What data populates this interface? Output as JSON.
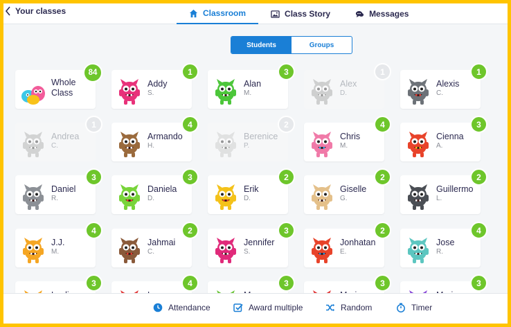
{
  "header": {
    "back_label": "Your classes",
    "tabs": [
      {
        "label": "Classroom",
        "icon": "home-icon",
        "active": true
      },
      {
        "label": "Class Story",
        "icon": "image-icon",
        "active": false
      },
      {
        "label": "Messages",
        "icon": "chat-icon",
        "active": false
      }
    ]
  },
  "toggle": {
    "students": "Students",
    "groups": "Groups",
    "selected": "Students"
  },
  "colors": {
    "accent": "#1a7fd6",
    "points_badge": "#6ec62b",
    "frame": "#ffc400"
  },
  "students": [
    {
      "first": "Whole Class",
      "initial": "",
      "points": "84",
      "absent": false,
      "monster": "group"
    },
    {
      "first": "Addy",
      "initial": "S.",
      "points": "1",
      "absent": false,
      "monster": "pink"
    },
    {
      "first": "Alan",
      "initial": "M.",
      "points": "3",
      "absent": false,
      "monster": "green-eye"
    },
    {
      "first": "Alex",
      "initial": "D.",
      "points": "1",
      "absent": true,
      "monster": "gray-tall"
    },
    {
      "first": "Alexis",
      "initial": "C.",
      "points": "1",
      "absent": false,
      "monster": "gray-eye"
    },
    {
      "first": "Andrea",
      "initial": "C.",
      "points": "1",
      "absent": true,
      "monster": "gray-robot"
    },
    {
      "first": "Armando",
      "initial": "H.",
      "points": "4",
      "absent": false,
      "monster": "brown-dog"
    },
    {
      "first": "Berenice",
      "initial": "P.",
      "points": "2",
      "absent": true,
      "monster": "gray-ghost"
    },
    {
      "first": "Chris",
      "initial": "M.",
      "points": "4",
      "absent": false,
      "monster": "pink-bear"
    },
    {
      "first": "Cienna",
      "initial": "A.",
      "points": "3",
      "absent": false,
      "monster": "red-bird"
    },
    {
      "first": "Daniel",
      "initial": "R.",
      "points": "3",
      "absent": false,
      "monster": "gray-cat"
    },
    {
      "first": "Daniela",
      "initial": "D.",
      "points": "3",
      "absent": false,
      "monster": "green-fuzzy"
    },
    {
      "first": "Erik",
      "initial": "D.",
      "points": "2",
      "absent": false,
      "monster": "yellow-octo"
    },
    {
      "first": "Giselle",
      "initial": "G.",
      "points": "2",
      "absent": false,
      "monster": "tan"
    },
    {
      "first": "Guillermo",
      "initial": "L.",
      "points": "2",
      "absent": false,
      "monster": "dark-gray"
    },
    {
      "first": "J.J.",
      "initial": "M.",
      "points": "4",
      "absent": false,
      "monster": "orange"
    },
    {
      "first": "Jahmai",
      "initial": "C.",
      "points": "2",
      "absent": false,
      "monster": "brown-egg"
    },
    {
      "first": "Jennifer",
      "initial": "S.",
      "points": "3",
      "absent": false,
      "monster": "magenta"
    },
    {
      "first": "Jonhatan",
      "initial": "E.",
      "points": "2",
      "absent": false,
      "monster": "red-horn"
    },
    {
      "first": "Jose",
      "initial": "R.",
      "points": "4",
      "absent": false,
      "monster": "teal-three-eye"
    },
    {
      "first": "Leslie",
      "initial": "",
      "points": "3",
      "absent": false,
      "monster": "orange"
    },
    {
      "first": "Lucero",
      "initial": "",
      "points": "4",
      "absent": false,
      "monster": "red"
    },
    {
      "first": "Maggy",
      "initial": "",
      "points": "3",
      "absent": false,
      "monster": "green"
    },
    {
      "first": "Maria",
      "initial": "",
      "points": "3",
      "absent": false,
      "monster": "red"
    },
    {
      "first": "Marina",
      "initial": "",
      "points": "3",
      "absent": false,
      "monster": "purple"
    }
  ],
  "footer": {
    "attendance": "Attendance",
    "award_multiple": "Award multiple",
    "random": "Random",
    "timer": "Timer"
  }
}
